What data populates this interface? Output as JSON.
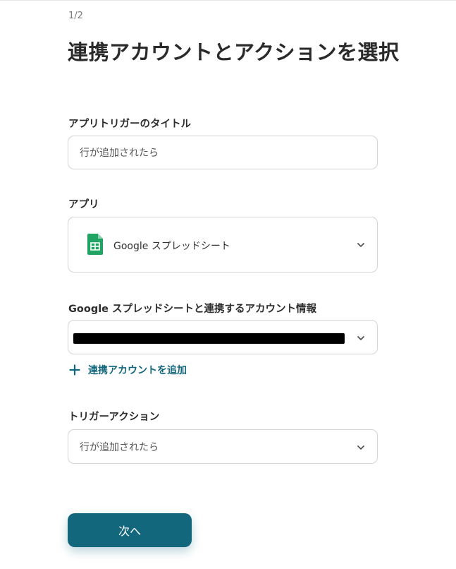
{
  "header": {
    "step": "1/2",
    "title": "連携アカウントとアクションを選択"
  },
  "form": {
    "trigger_title": {
      "label": "アプリトリガーのタイトル",
      "value": "行が追加されたら"
    },
    "app": {
      "label": "アプリ",
      "selected": "Google スプレッドシート",
      "icon": "google-sheets-icon"
    },
    "account": {
      "label": "Google スプレッドシートと連携するアカウント情報",
      "value": "",
      "redacted": true
    },
    "add_account": {
      "label": "連携アカウントを追加",
      "icon": "plus-icon"
    },
    "trigger_action": {
      "label": "トリガーアクション",
      "selected": "行が追加されたら"
    }
  },
  "actions": {
    "next_label": "次へ"
  },
  "colors": {
    "accent": "#13677d",
    "sheets_green": "#1fa463"
  }
}
